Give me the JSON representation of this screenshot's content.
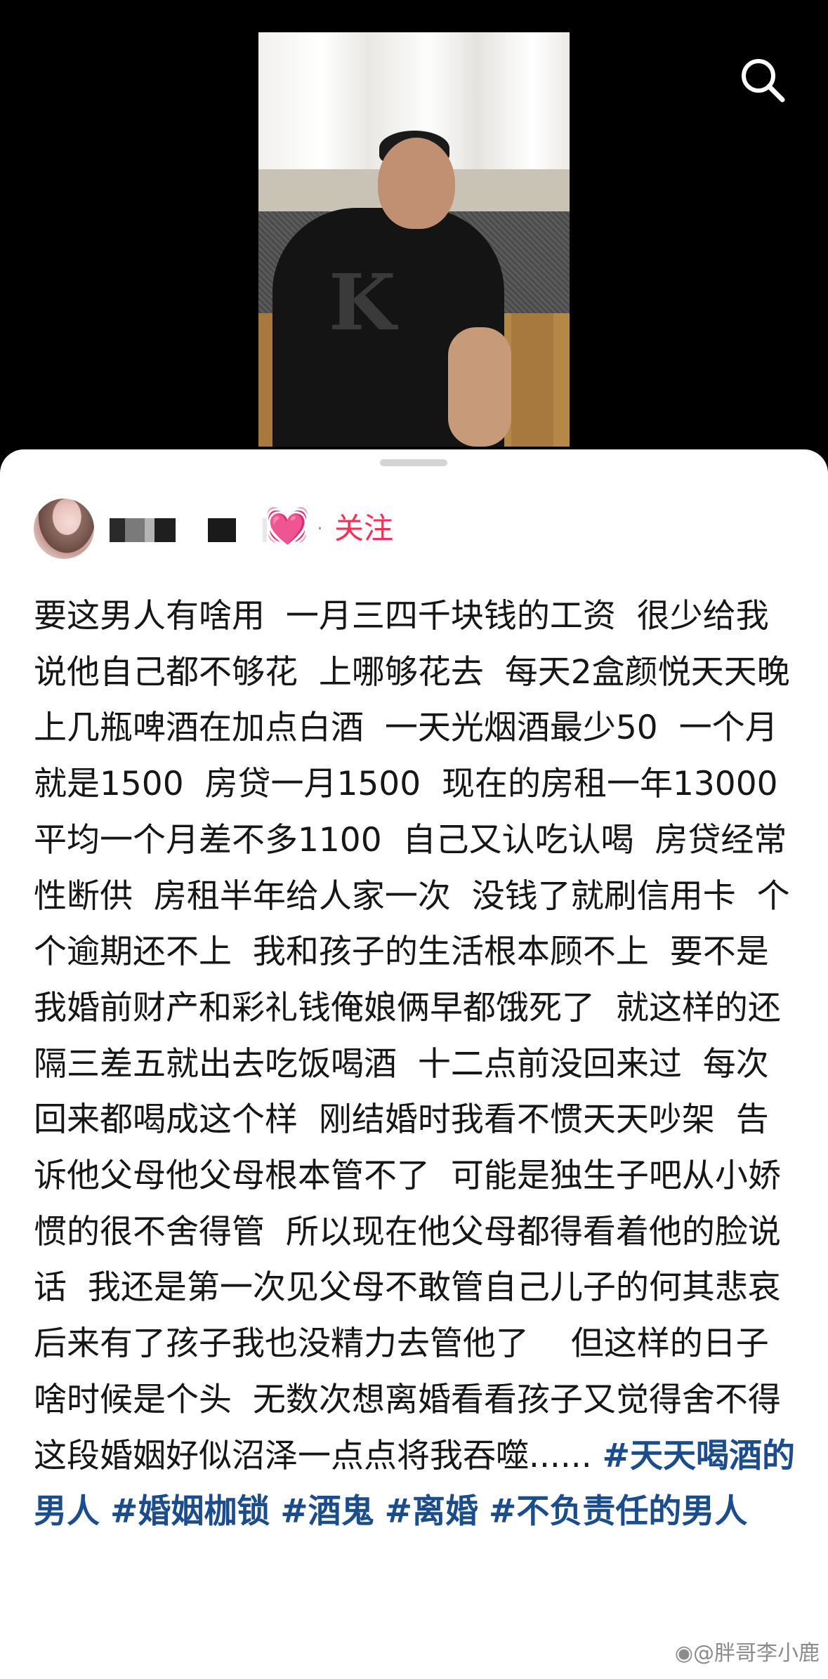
{
  "header": {
    "search_icon": "search-icon"
  },
  "video": {
    "shirt_logo": "K"
  },
  "author": {
    "name_masked": true,
    "heart_icon": "💓",
    "separator": "·",
    "follow_label": "关注"
  },
  "post": {
    "text": "要这男人有啥用  一月三四千块钱的工资  很少给我  说他自己都不够花  上哪够花去  每天2盒颜悦天天晚上几瓶啤酒在加点白酒  一天光烟酒最少50  一个月就是1500  房贷一月1500  现在的房租一年13000  平均一个月差不多1100  自己又认吃认喝  房贷经常性断供  房租半年给人家一次  没钱了就刷信用卡  个个逾期还不上  我和孩子的生活根本顾不上  要不是我婚前财产和彩礼钱俺娘俩早都饿死了  就这样的还隔三差五就出去吃饭喝酒  十二点前没回来过  每次回来都喝成这个样  刚结婚时我看不惯天天吵架  告诉他父母他父母根本管不了  可能是独生子吧从小娇惯的很不舍得管  所以现在他父母都得看着他的脸说话  我还是第一次见父母不敢管自己儿子的何其悲哀  后来有了孩子我也没精力去管他了    但这样的日子啥时候是个头  无数次想离婚看看孩子又觉得舍不得  这段婚姻好似沼泽一点点将我吞噬......",
    "tags": [
      "#天天喝酒的男人",
      "#婚姻枷锁",
      "#酒鬼",
      "#离婚",
      "#不负责任的男人"
    ]
  },
  "watermark": {
    "text": "@胖哥李小鹿",
    "icon": "weibo-icon"
  }
}
